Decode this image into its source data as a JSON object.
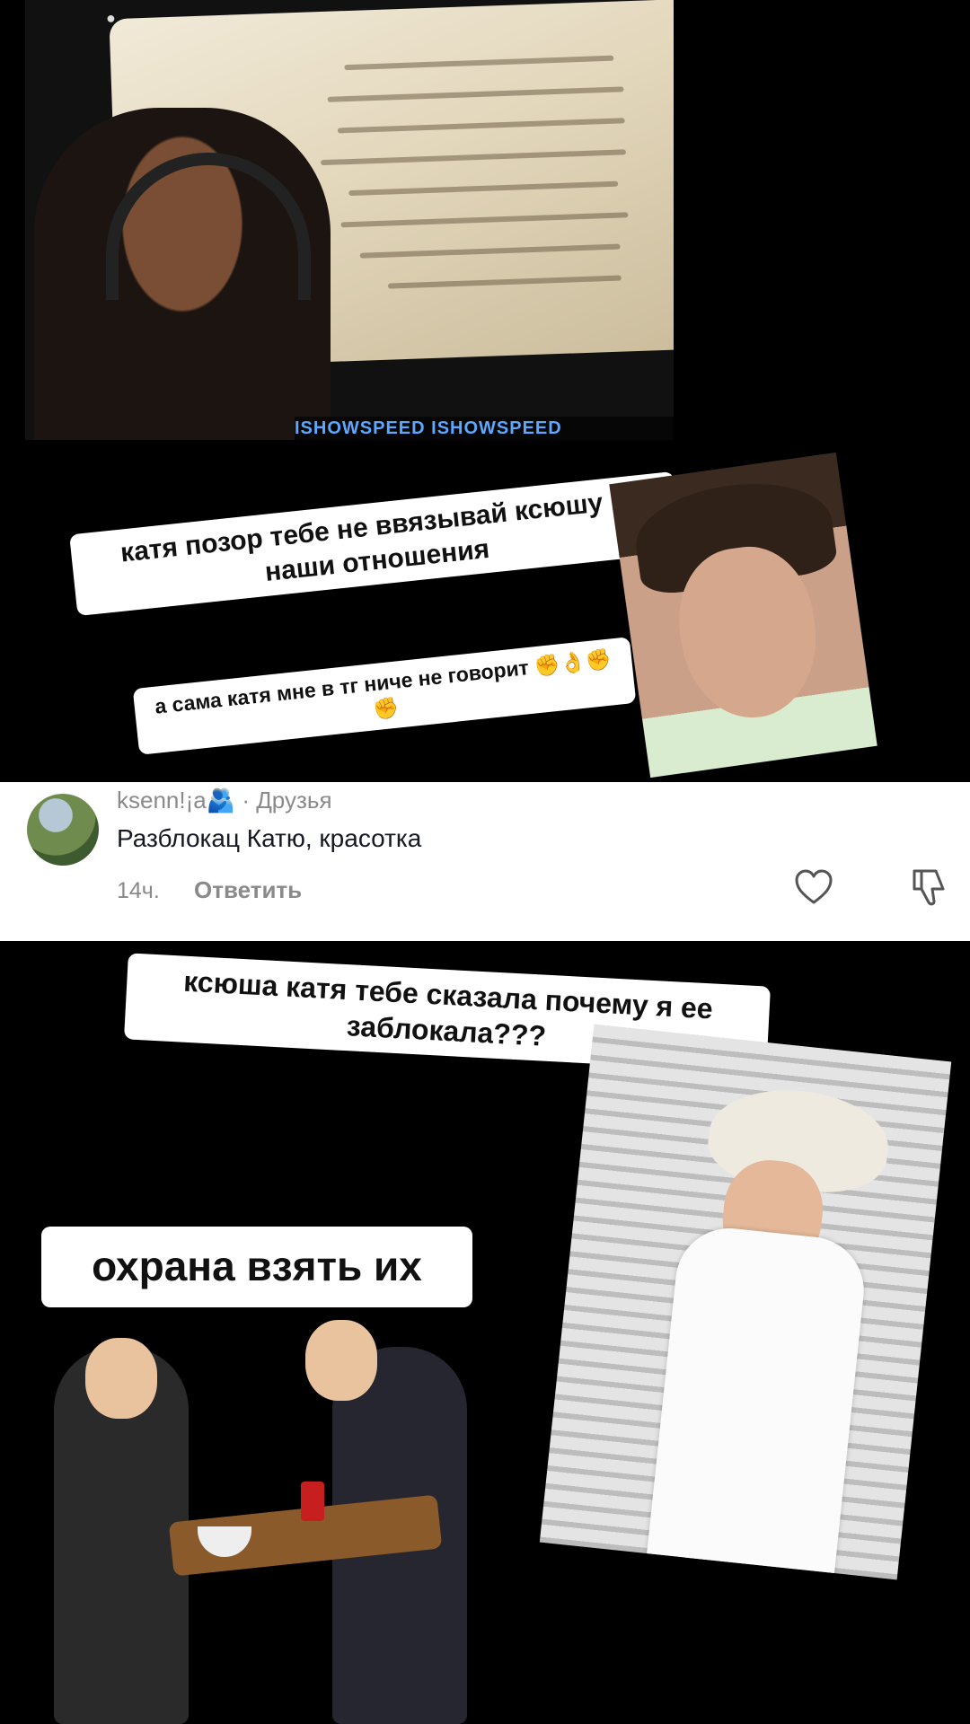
{
  "top_video": {
    "watermark": "ISHOWSPEED  ISHOWSPEED"
  },
  "captions": {
    "caption_1": "катя позор тебе не ввязывай ксюшу в наши отношения",
    "caption_2": "а сама катя мне в тг ниче не говорит ✊👌✊✊",
    "caption_3": "ксюша катя тебе сказала почему я ее заблокала???",
    "caption_4": "охрана взять их"
  },
  "comment": {
    "username": "ksenn!¡a🫂 · Друзья",
    "text": "Разблокац Катю, красотка",
    "time": "14ч.",
    "reply_label": "Ответить"
  },
  "icons": [
    "heart-icon",
    "dislike-icon"
  ],
  "colors": {
    "background": "#000000",
    "card": "#ffffff",
    "muted_text": "#8a8a8a",
    "comment_text": "#161823"
  }
}
